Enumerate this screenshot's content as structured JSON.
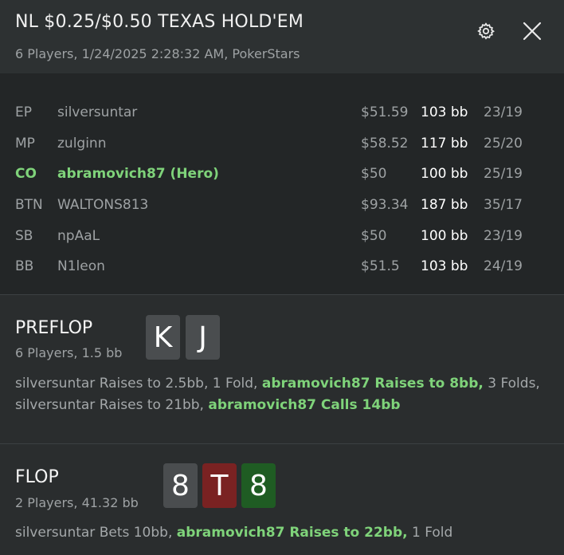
{
  "header": {
    "title": "NL $0.25/$0.50 TEXAS HOLD'EM",
    "subtitle": "6 Players, 1/24/2025 2:28:32 AM, PokerStars",
    "settings_icon": "gear-icon",
    "close_icon": "close-icon"
  },
  "players": [
    {
      "pos": "EP",
      "name": "silversuntar",
      "stack": "$51.59",
      "bb": "103 bb",
      "stats": "23/19"
    },
    {
      "pos": "MP",
      "name": "zulginn",
      "stack": "$58.52",
      "bb": "117 bb",
      "stats": "25/20"
    },
    {
      "pos": "CO",
      "name": "abramovich87 (Hero)",
      "stack": "$50",
      "bb": "100 bb",
      "stats": "25/19"
    },
    {
      "pos": "BTN",
      "name": "WALTONS813",
      "stack": "$93.34",
      "bb": "187 bb",
      "stats": "35/17"
    },
    {
      "pos": "SB",
      "name": "npAaL",
      "stack": "$50",
      "bb": "100 bb",
      "stats": "23/19"
    },
    {
      "pos": "BB",
      "name": "N1leon",
      "stack": "$51.5",
      "bb": "103 bb",
      "stats": "24/19"
    }
  ],
  "preflop": {
    "title": "PREFLOP",
    "subtitle": "6 Players, 1.5 bb",
    "cards": [
      {
        "rank": "K",
        "color": "#4a4d4f"
      },
      {
        "rank": "J",
        "color": "#4a4d4f"
      }
    ],
    "actions": {
      "a1": "silversuntar Raises to 2.5bb, 1 Fold, ",
      "a2": "abramovich87 Raises to 8bb,",
      "a3": " 3 Folds, silversuntar Raises to 21bb, ",
      "a4": "abramovich87 Calls 14bb"
    }
  },
  "flop": {
    "title": "FLOP",
    "subtitle": "2 Players, 41.32 bb",
    "cards": [
      {
        "rank": "8",
        "color": "#4a4d4f"
      },
      {
        "rank": "T",
        "color": "#7a2222"
      },
      {
        "rank": "8",
        "color": "#1f5c23"
      }
    ],
    "actions": {
      "a1": "silversuntar Bets 10bb, ",
      "a2": "abramovich87 Raises to 22bb,",
      "a3": " 1 Fold"
    }
  },
  "colors": {
    "hero_green": "#7fd37a",
    "card_gray": "#4a4d4f",
    "card_red": "#7a2222",
    "card_green": "#1f5c23"
  }
}
